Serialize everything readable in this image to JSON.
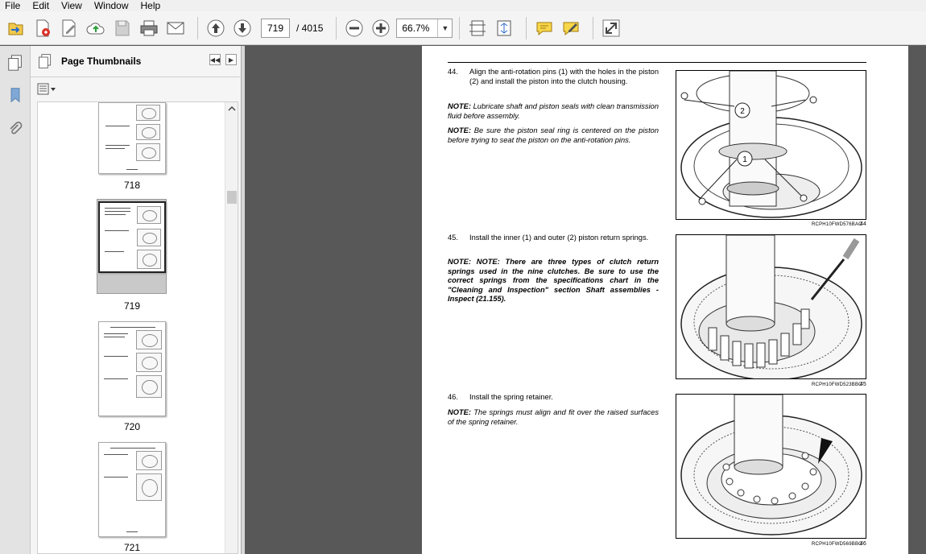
{
  "menu": [
    "File",
    "Edit",
    "View",
    "Window",
    "Help"
  ],
  "toolbar": {
    "current_page": "719",
    "total_pages": "/ 4015",
    "zoom": "66.7%"
  },
  "panel": {
    "title": "Page Thumbnails"
  },
  "thumbnails": [
    {
      "label": "718"
    },
    {
      "label": "719"
    },
    {
      "label": "720"
    },
    {
      "label": "721"
    }
  ],
  "document": {
    "steps": [
      {
        "num": "44.",
        "text": "Align the anti-rotation pins (1) with the holes in the piston (2) and install the piston into the clutch housing."
      },
      {
        "num": "45.",
        "text": "Install the inner (1) and outer (2) piston return springs."
      },
      {
        "num": "46.",
        "text": "Install the spring retainer."
      }
    ],
    "notes": [
      {
        "label": "NOTE:",
        "text": "Lubricate shaft and piston seals with clean transmission fluid before assembly."
      },
      {
        "label": "NOTE:",
        "text": "Be sure the piston seal ring is centered on the piston before trying to seat the piston on the anti-rotation pins."
      },
      {
        "label": "NOTE:",
        "text": "NOTE: There are three types of clutch return springs used in the nine clutches. Be sure to use the correct springs from the specifications chart in the \"Cleaning and Inspection\" section Shaft assemblies - Inspect (21.155)."
      },
      {
        "label": "NOTE:",
        "text": "The springs must align and fit over the raised surfaces of the spring retainer."
      }
    ],
    "figures": [
      {
        "caption": "RCPH10FWD576BAC",
        "number": "44",
        "callouts": [
          "2",
          "1"
        ]
      },
      {
        "caption": "RCPH10FWD523BBC",
        "number": "45"
      },
      {
        "caption": "RCPH10FWD569BBC",
        "number": "46"
      }
    ]
  }
}
